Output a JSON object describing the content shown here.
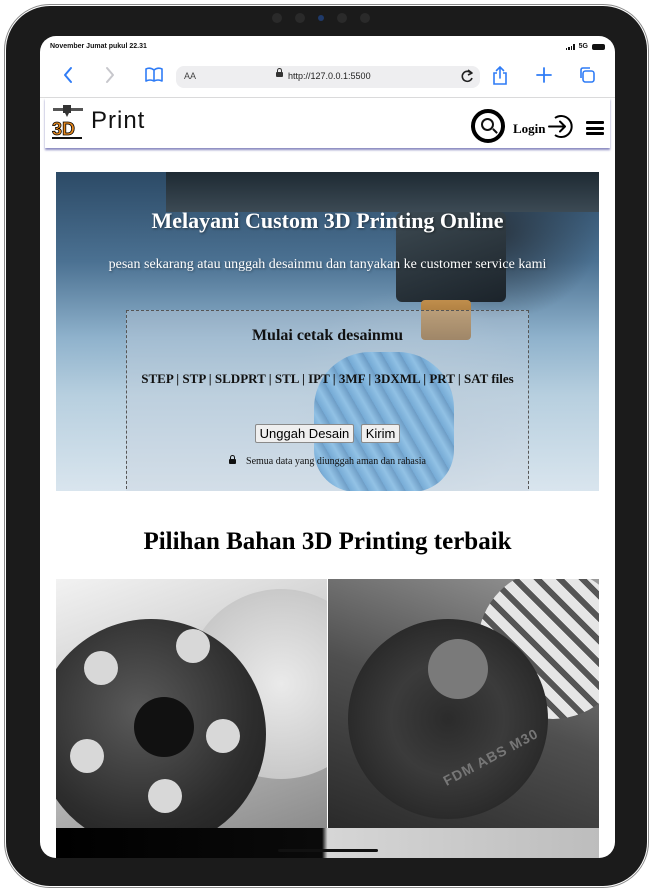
{
  "status_bar": {
    "time": "November Jumat pukul 22.31",
    "network": "5G"
  },
  "browser": {
    "text_size_label": "AA",
    "url": "http://127.0.0.1:5500",
    "icons": [
      "back-icon",
      "forward-icon",
      "bookmarks-icon",
      "reload-icon",
      "share-icon",
      "new-tab-icon",
      "tabs-icon"
    ]
  },
  "header": {
    "logo_text": "Print",
    "login_label": "Login",
    "icons": [
      "search-icon",
      "login-arrow-icon",
      "menu-icon"
    ]
  },
  "hero": {
    "title": "Melayani Custom 3D Printing Online",
    "subtitle": "pesan sekarang atau unggah desainmu dan tanyakan ke customer service kami",
    "upload": {
      "title": "Mulai cetak desainmu",
      "file_types": "STEP | STP | SLDPRT | STL | IPT | 3MF | 3DXML | PRT | SAT files",
      "upload_button": "Unggah Desain",
      "submit_button": "Kirim",
      "secure_note": "Semua data yang diunggah aman dan rahasia"
    }
  },
  "materials": {
    "title": "Pilihan Bahan 3D Printing terbaik",
    "embossed_text": "FDM ABS M30"
  },
  "colors": {
    "safari_blue": "#2f7cf6",
    "header_shadow": "#2e2e8c",
    "logo_orange": "#e98a1e"
  }
}
